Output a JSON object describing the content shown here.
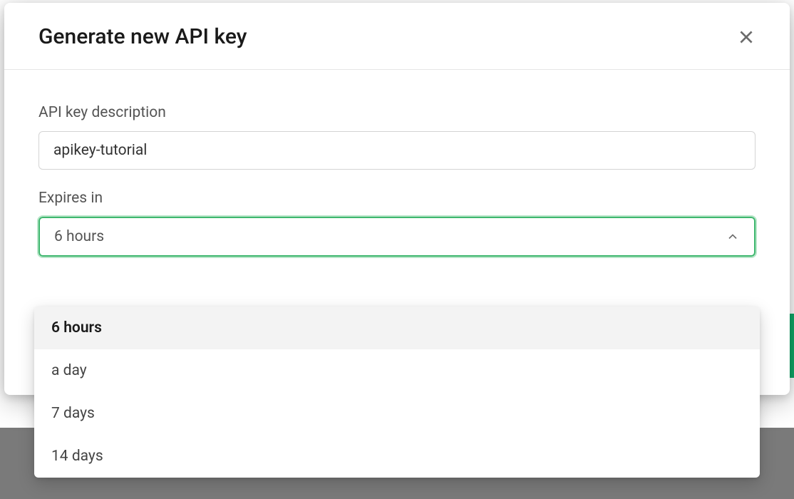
{
  "modal": {
    "title": "Generate new API key",
    "description_label": "API key description",
    "description_value": "apikey-tutorial",
    "expires_label": "Expires in",
    "expires_selected": "6 hours",
    "expires_options": [
      {
        "label": "6 hours",
        "selected": true
      },
      {
        "label": "a day",
        "selected": false
      },
      {
        "label": "7 days",
        "selected": false
      },
      {
        "label": "14 days",
        "selected": false
      }
    ]
  }
}
